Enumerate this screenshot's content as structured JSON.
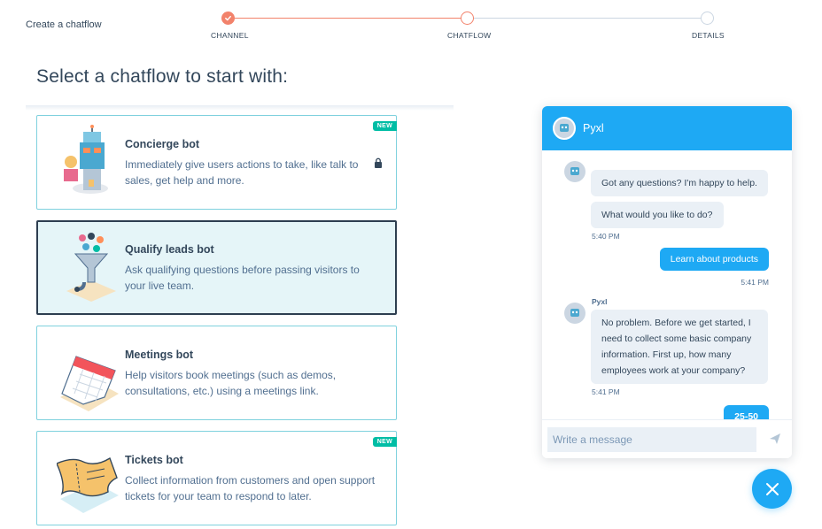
{
  "header": {
    "title": "Create a chatflow"
  },
  "stepper": {
    "steps": [
      {
        "label": "CHANNEL",
        "state": "complete"
      },
      {
        "label": "CHATFLOW",
        "state": "current"
      },
      {
        "label": "DETAILS",
        "state": "upcoming"
      }
    ]
  },
  "main": {
    "heading": "Select a chatflow to start with:",
    "cards": [
      {
        "title": "Concierge bot",
        "description": "Immediately give users actions to take, like talk to sales, get help and more.",
        "badge": "NEW",
        "icon": "concierge-robot-illustration",
        "locked": true
      },
      {
        "title": "Qualify leads bot",
        "description": "Ask qualifying questions before passing visitors to your live team.",
        "icon": "funnel-illustration",
        "selected": true
      },
      {
        "title": "Meetings bot",
        "description": "Help visitors book meetings (such as demos, consultations, etc.) using a meetings link.",
        "icon": "calendar-illustration"
      },
      {
        "title": "Tickets bot",
        "description": "Collect information from customers and open support tickets for your team to respond to later.",
        "badge": "NEW",
        "icon": "ticket-illustration"
      }
    ]
  },
  "chat": {
    "bot_name": "Pyxl",
    "messages": [
      {
        "from": "bot",
        "text": "Got any questions? I'm happy to help."
      },
      {
        "from": "bot",
        "text": "What would you like to do?",
        "time": "5:40 PM"
      },
      {
        "from": "user",
        "text": "Learn about products",
        "time": "5:41 PM"
      },
      {
        "from": "bot",
        "sender": "Pyxl",
        "text": "No problem. Before we get started, I need to collect some basic company information. First up, how many employees work at your company?",
        "time": "5:41 PM"
      },
      {
        "from": "user",
        "text": "25-50"
      }
    ],
    "input_placeholder": "Write a message"
  },
  "colors": {
    "accent": "#1ea9f4",
    "stepper_active": "#f2826b",
    "card_border": "#7fd1de",
    "selected_border": "#2d3e50",
    "badge": "#00bda5"
  }
}
